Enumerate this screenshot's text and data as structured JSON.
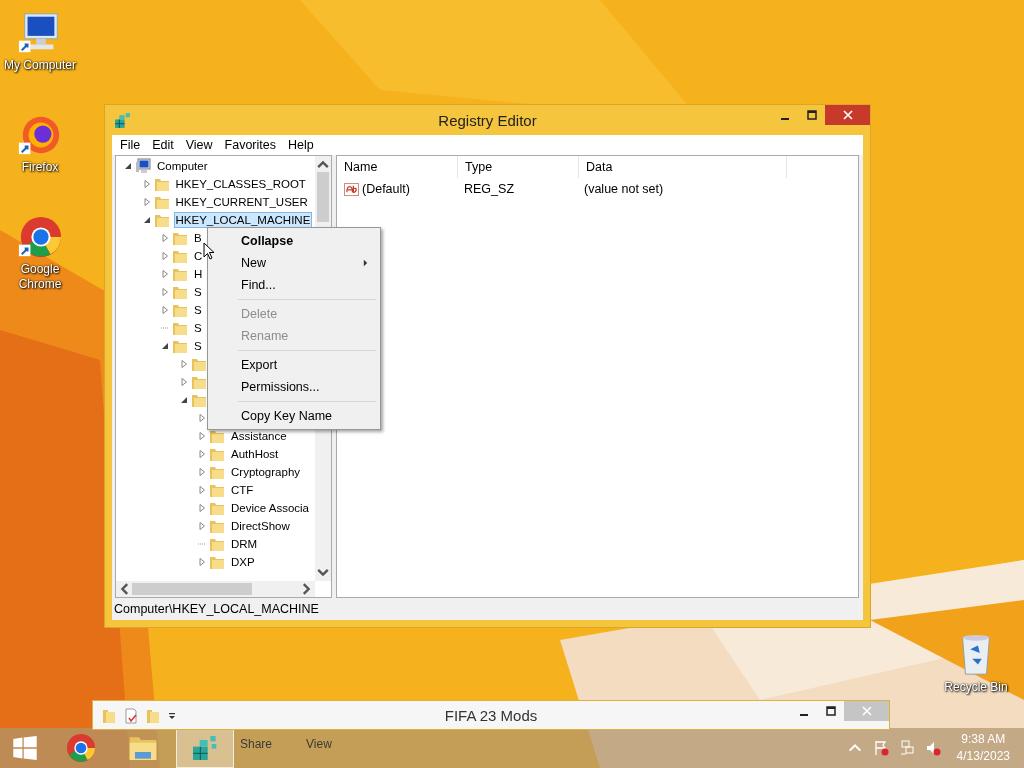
{
  "desktop_icons": [
    {
      "label": "My Computer",
      "kind": "computer"
    },
    {
      "label": "Firefox",
      "kind": "firefox"
    },
    {
      "label": "Google Chrome",
      "kind": "chrome"
    },
    {
      "label": "Recycle Bin",
      "kind": "bin"
    }
  ],
  "registry_window": {
    "title": "Registry Editor",
    "menu_bar": [
      "File",
      "Edit",
      "View",
      "Favorites",
      "Help"
    ],
    "tree": [
      {
        "label": "Computer",
        "kind": "computer",
        "expanded": true,
        "selected": false,
        "children": [
          {
            "label": "HKEY_CLASSES_ROOT",
            "expandable": true,
            "expanded": false,
            "selected": false
          },
          {
            "label": "HKEY_CURRENT_USER",
            "expandable": true,
            "expanded": false,
            "selected": false
          },
          {
            "label": "HKEY_LOCAL_MACHINE",
            "expandable": true,
            "expanded": true,
            "selected": true,
            "children": [
              {
                "label": "B",
                "expandable": true,
                "expanded": false,
                "selected": false
              },
              {
                "label": "C",
                "expandable": true,
                "expanded": false,
                "selected": false
              },
              {
                "label": "H",
                "expandable": true,
                "expanded": false,
                "selected": false
              },
              {
                "label": "S",
                "expandable": true,
                "expanded": false,
                "selected": false
              },
              {
                "label": "S",
                "expandable": true,
                "expanded": false,
                "selected": false
              },
              {
                "label": "S",
                "expandable": false,
                "expanded": false,
                "selected": false
              },
              {
                "label": "S",
                "expandable": true,
                "expanded": true,
                "selected": false,
                "children": [
                  {
                    "expandable": true,
                    "expanded": false
                  },
                  {
                    "expandable": true,
                    "expanded": false
                  },
                  {
                    "expandable": true,
                    "expanded": true,
                    "children": [
                      {
                        "expandable": true,
                        "expanded": false
                      },
                      {
                        "label": "Assistance",
                        "expandable": true,
                        "expanded": false,
                        "selected": false
                      },
                      {
                        "label": "AuthHost",
                        "expandable": true,
                        "expanded": false,
                        "selected": false
                      },
                      {
                        "label": "Cryptography",
                        "expandable": true,
                        "expanded": false,
                        "selected": false
                      },
                      {
                        "label": "CTF",
                        "expandable": true,
                        "expanded": false,
                        "selected": false
                      },
                      {
                        "label": "Device Associa",
                        "expandable": true,
                        "expanded": false,
                        "selected": false
                      },
                      {
                        "label": "DirectShow",
                        "expandable": true,
                        "expanded": false,
                        "selected": false
                      },
                      {
                        "label": "DRM",
                        "expandable": false,
                        "expanded": false,
                        "selected": false
                      },
                      {
                        "label": "DXP",
                        "expandable": true,
                        "expanded": false,
                        "selected": false
                      }
                    ]
                  }
                ]
              }
            ]
          }
        ]
      }
    ],
    "columns": [
      "Name",
      "Type",
      "Data"
    ],
    "values": [
      {
        "name": "(Default)",
        "type": "REG_SZ",
        "data": "(value not set)"
      }
    ],
    "status_bar": "Computer\\HKEY_LOCAL_MACHINE"
  },
  "context_menu": [
    {
      "kind": "item",
      "label": "Collapse",
      "bold": true,
      "disabled": false,
      "submenu": false
    },
    {
      "kind": "item",
      "label": "New",
      "bold": false,
      "disabled": false,
      "submenu": true
    },
    {
      "kind": "item",
      "label": "Find...",
      "bold": false,
      "disabled": false,
      "submenu": false
    },
    {
      "kind": "separator"
    },
    {
      "kind": "item",
      "label": "Delete",
      "bold": false,
      "disabled": true,
      "submenu": false
    },
    {
      "kind": "item",
      "label": "Rename",
      "bold": false,
      "disabled": true,
      "submenu": false
    },
    {
      "kind": "separator"
    },
    {
      "kind": "item",
      "label": "Export",
      "bold": false,
      "disabled": false,
      "submenu": false
    },
    {
      "kind": "item",
      "label": "Permissions...",
      "bold": false,
      "disabled": false,
      "submenu": false
    },
    {
      "kind": "separator"
    },
    {
      "kind": "item",
      "label": "Copy Key Name",
      "bold": false,
      "disabled": false,
      "submenu": false
    }
  ],
  "explorer_window": {
    "title": "FIFA 23 Mods",
    "ribbon_tabs": [
      "Share",
      "View"
    ]
  },
  "taskbar": {
    "apps": [
      {
        "kind": "chrome",
        "selected": false
      },
      {
        "kind": "explorer",
        "selected": false
      },
      {
        "kind": "regedit",
        "selected": true
      }
    ],
    "time": "9:38 AM",
    "date": "4/13/2023"
  }
}
